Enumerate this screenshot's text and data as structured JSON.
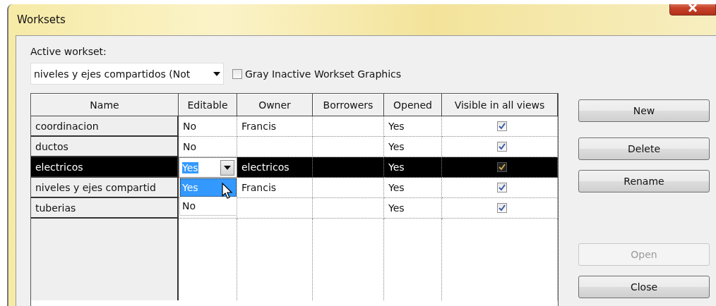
{
  "window": {
    "title": "Worksets"
  },
  "active_workset": {
    "label": "Active workset:",
    "value": "niveles y ejes compartidos (Not"
  },
  "gray_inactive": {
    "label": "Gray Inactive Workset Graphics",
    "checked": false
  },
  "table": {
    "columns": [
      "Name",
      "Editable",
      "Owner",
      "Borrowers",
      "Opened",
      "Visible in all views"
    ],
    "rows": [
      {
        "name": "coordinacion",
        "editable": "No",
        "owner": "Francis",
        "opened": "Yes",
        "visible": true,
        "selected": false
      },
      {
        "name": "ductos",
        "editable": "No",
        "opened": "Yes",
        "visible": true,
        "selected": false
      },
      {
        "name": "electricos",
        "editable": "Yes",
        "owner": "electricos",
        "opened": "Yes",
        "visible": true,
        "selected": true,
        "editing": true
      },
      {
        "name": "niveles y ejes compartid",
        "owner": "Francis",
        "opened": "Yes",
        "visible": true,
        "selected": false
      },
      {
        "name": "tuberias",
        "opened": "Yes",
        "visible": true,
        "selected": false
      }
    ],
    "dropdown_options": [
      {
        "label": "Yes",
        "selected": true
      },
      {
        "label": "No",
        "selected": false
      }
    ]
  },
  "buttons": [
    {
      "label": "New",
      "disabled": false
    },
    {
      "label": "Delete",
      "disabled": false
    },
    {
      "label": "Rename",
      "disabled": false
    },
    {
      "label": "Open",
      "disabled": true
    },
    {
      "label": "Close",
      "disabled": false
    }
  ]
}
